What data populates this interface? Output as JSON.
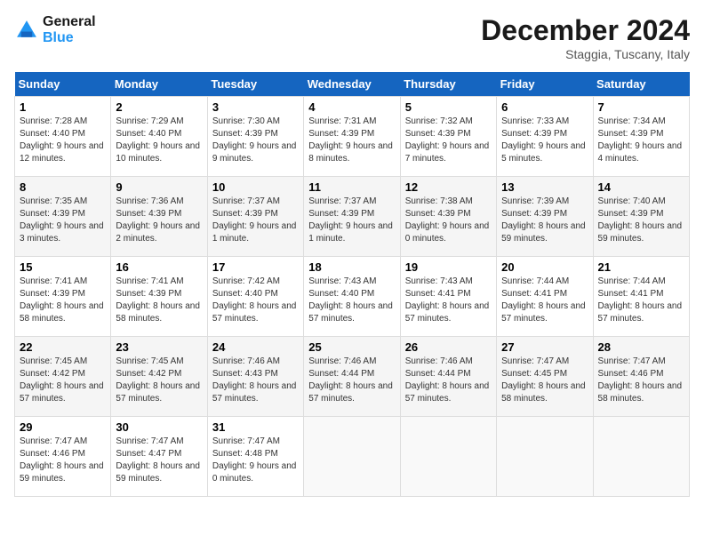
{
  "header": {
    "logo_text_general": "General",
    "logo_text_blue": "Blue",
    "month_title": "December 2024",
    "location": "Staggia, Tuscany, Italy"
  },
  "weekdays": [
    "Sunday",
    "Monday",
    "Tuesday",
    "Wednesday",
    "Thursday",
    "Friday",
    "Saturday"
  ],
  "weeks": [
    [
      {
        "day": "1",
        "sunrise": "7:28 AM",
        "sunset": "4:40 PM",
        "daylight": "9 hours and 12 minutes."
      },
      {
        "day": "2",
        "sunrise": "7:29 AM",
        "sunset": "4:40 PM",
        "daylight": "9 hours and 10 minutes."
      },
      {
        "day": "3",
        "sunrise": "7:30 AM",
        "sunset": "4:39 PM",
        "daylight": "9 hours and 9 minutes."
      },
      {
        "day": "4",
        "sunrise": "7:31 AM",
        "sunset": "4:39 PM",
        "daylight": "9 hours and 8 minutes."
      },
      {
        "day": "5",
        "sunrise": "7:32 AM",
        "sunset": "4:39 PM",
        "daylight": "9 hours and 7 minutes."
      },
      {
        "day": "6",
        "sunrise": "7:33 AM",
        "sunset": "4:39 PM",
        "daylight": "9 hours and 5 minutes."
      },
      {
        "day": "7",
        "sunrise": "7:34 AM",
        "sunset": "4:39 PM",
        "daylight": "9 hours and 4 minutes."
      }
    ],
    [
      {
        "day": "8",
        "sunrise": "7:35 AM",
        "sunset": "4:39 PM",
        "daylight": "9 hours and 3 minutes."
      },
      {
        "day": "9",
        "sunrise": "7:36 AM",
        "sunset": "4:39 PM",
        "daylight": "9 hours and 2 minutes."
      },
      {
        "day": "10",
        "sunrise": "7:37 AM",
        "sunset": "4:39 PM",
        "daylight": "9 hours and 1 minute."
      },
      {
        "day": "11",
        "sunrise": "7:37 AM",
        "sunset": "4:39 PM",
        "daylight": "9 hours and 1 minute."
      },
      {
        "day": "12",
        "sunrise": "7:38 AM",
        "sunset": "4:39 PM",
        "daylight": "9 hours and 0 minutes."
      },
      {
        "day": "13",
        "sunrise": "7:39 AM",
        "sunset": "4:39 PM",
        "daylight": "8 hours and 59 minutes."
      },
      {
        "day": "14",
        "sunrise": "7:40 AM",
        "sunset": "4:39 PM",
        "daylight": "8 hours and 59 minutes."
      }
    ],
    [
      {
        "day": "15",
        "sunrise": "7:41 AM",
        "sunset": "4:39 PM",
        "daylight": "8 hours and 58 minutes."
      },
      {
        "day": "16",
        "sunrise": "7:41 AM",
        "sunset": "4:39 PM",
        "daylight": "8 hours and 58 minutes."
      },
      {
        "day": "17",
        "sunrise": "7:42 AM",
        "sunset": "4:40 PM",
        "daylight": "8 hours and 57 minutes."
      },
      {
        "day": "18",
        "sunrise": "7:43 AM",
        "sunset": "4:40 PM",
        "daylight": "8 hours and 57 minutes."
      },
      {
        "day": "19",
        "sunrise": "7:43 AM",
        "sunset": "4:41 PM",
        "daylight": "8 hours and 57 minutes."
      },
      {
        "day": "20",
        "sunrise": "7:44 AM",
        "sunset": "4:41 PM",
        "daylight": "8 hours and 57 minutes."
      },
      {
        "day": "21",
        "sunrise": "7:44 AM",
        "sunset": "4:41 PM",
        "daylight": "8 hours and 57 minutes."
      }
    ],
    [
      {
        "day": "22",
        "sunrise": "7:45 AM",
        "sunset": "4:42 PM",
        "daylight": "8 hours and 57 minutes."
      },
      {
        "day": "23",
        "sunrise": "7:45 AM",
        "sunset": "4:42 PM",
        "daylight": "8 hours and 57 minutes."
      },
      {
        "day": "24",
        "sunrise": "7:46 AM",
        "sunset": "4:43 PM",
        "daylight": "8 hours and 57 minutes."
      },
      {
        "day": "25",
        "sunrise": "7:46 AM",
        "sunset": "4:44 PM",
        "daylight": "8 hours and 57 minutes."
      },
      {
        "day": "26",
        "sunrise": "7:46 AM",
        "sunset": "4:44 PM",
        "daylight": "8 hours and 57 minutes."
      },
      {
        "day": "27",
        "sunrise": "7:47 AM",
        "sunset": "4:45 PM",
        "daylight": "8 hours and 58 minutes."
      },
      {
        "day": "28",
        "sunrise": "7:47 AM",
        "sunset": "4:46 PM",
        "daylight": "8 hours and 58 minutes."
      }
    ],
    [
      {
        "day": "29",
        "sunrise": "7:47 AM",
        "sunset": "4:46 PM",
        "daylight": "8 hours and 59 minutes."
      },
      {
        "day": "30",
        "sunrise": "7:47 AM",
        "sunset": "4:47 PM",
        "daylight": "8 hours and 59 minutes."
      },
      {
        "day": "31",
        "sunrise": "7:47 AM",
        "sunset": "4:48 PM",
        "daylight": "9 hours and 0 minutes."
      },
      null,
      null,
      null,
      null
    ]
  ]
}
